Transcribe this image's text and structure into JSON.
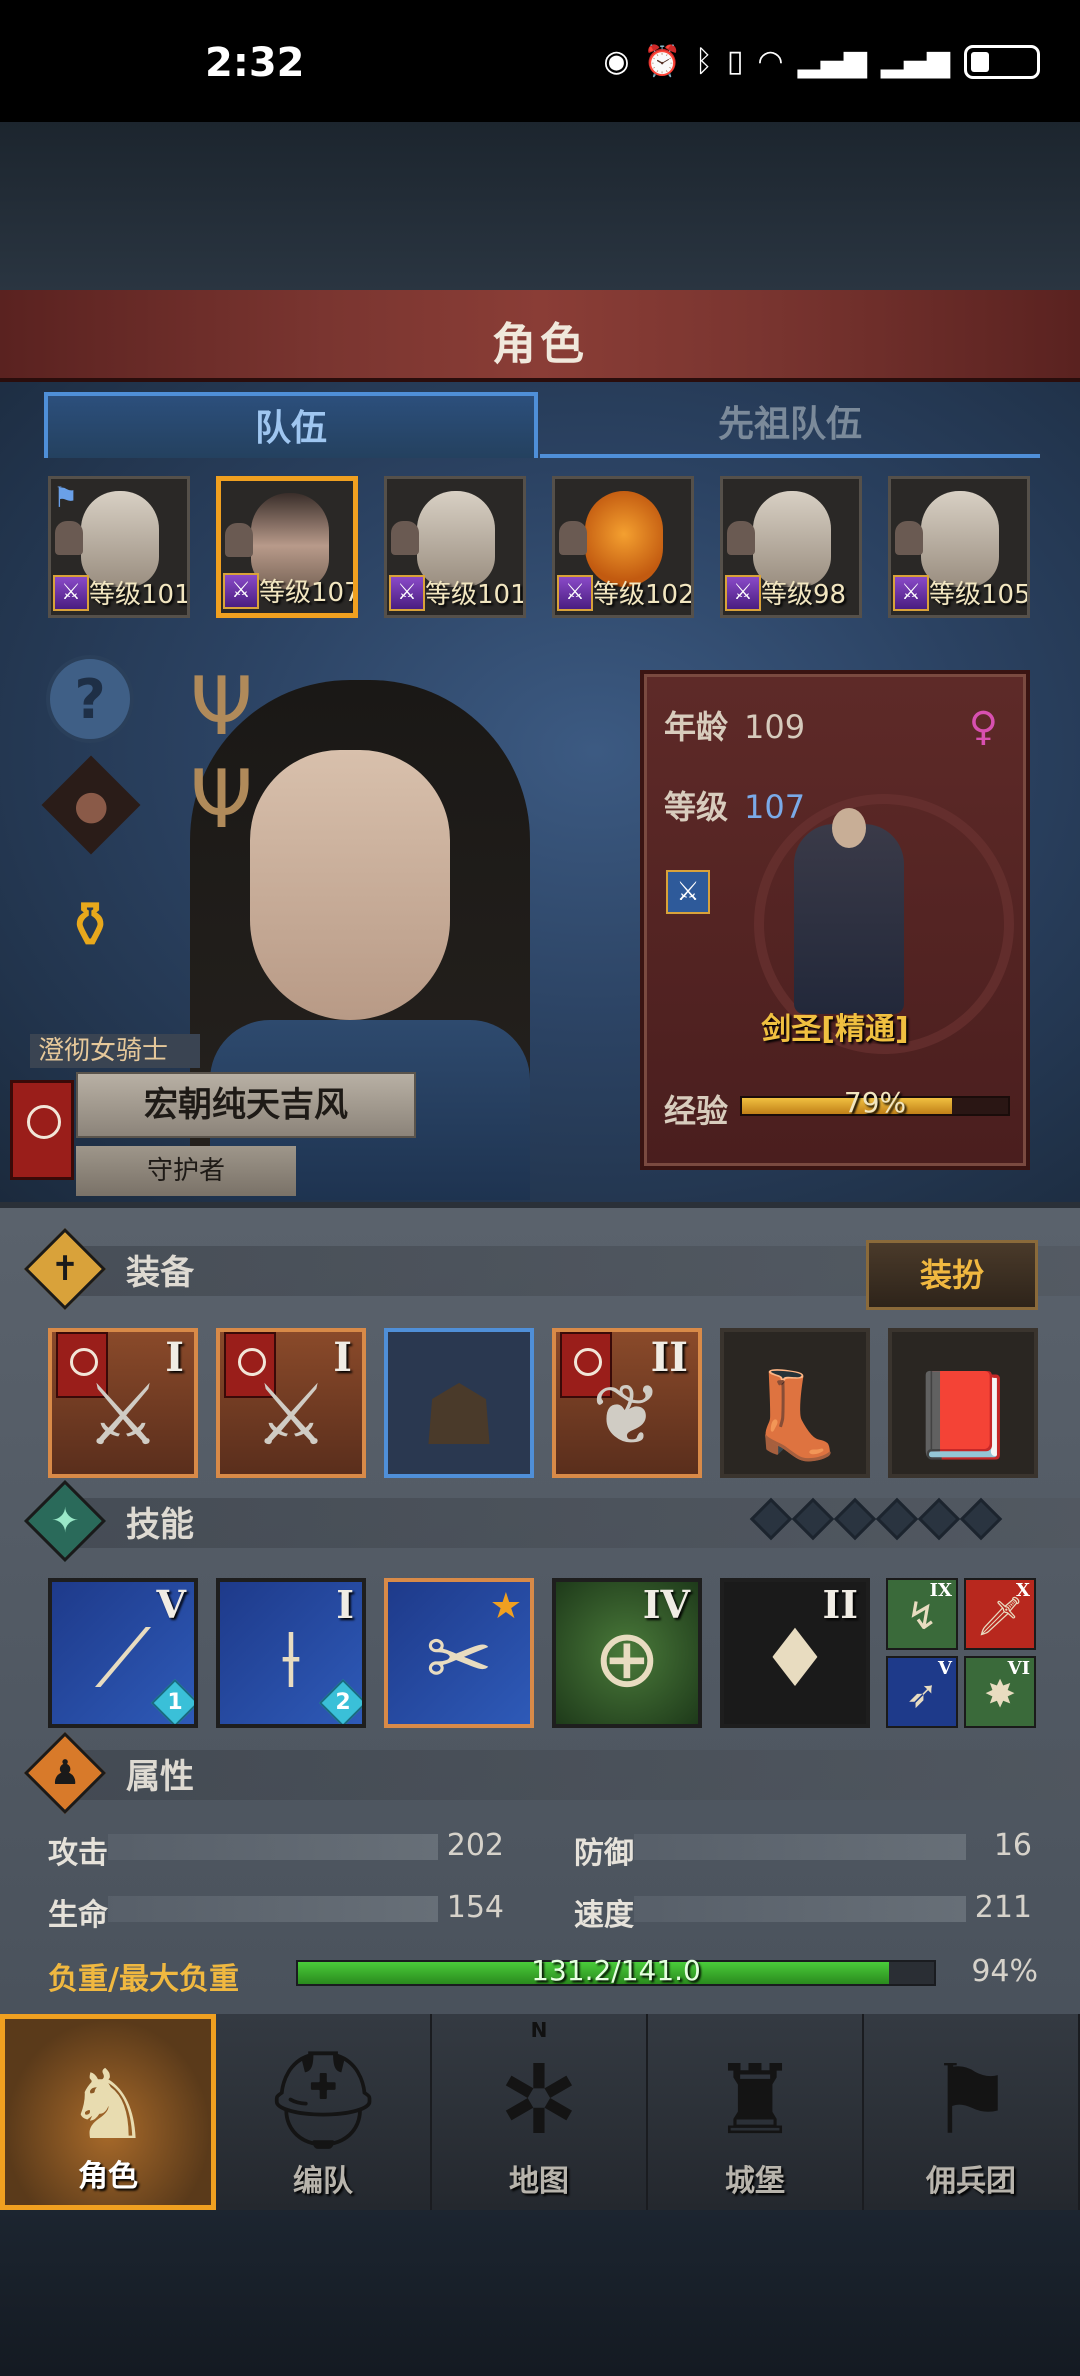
{
  "status_bar": {
    "time": "2:32",
    "icons": [
      "eye-icon",
      "alarm-icon",
      "bluetooth-icon",
      "vibrate-icon",
      "wifi-icon",
      "signal-4g-icon",
      "signal-5g-icon",
      "battery-icon"
    ]
  },
  "header": {
    "title": "角色"
  },
  "tabs": [
    {
      "label": "队伍",
      "active": true
    },
    {
      "label": "先祖队伍",
      "active": false
    }
  ],
  "roster": [
    {
      "level": "等级101",
      "flag": true,
      "selected": false,
      "face": "light"
    },
    {
      "level": "等级107",
      "flag": false,
      "selected": true,
      "face": "dark"
    },
    {
      "level": "等级101",
      "flag": false,
      "selected": false,
      "face": "light"
    },
    {
      "level": "等级102",
      "flag": false,
      "selected": false,
      "face": "pumpkin"
    },
    {
      "level": "等级98",
      "flag": false,
      "selected": false,
      "face": "light"
    },
    {
      "level": "等级105",
      "flag": false,
      "selected": false,
      "face": "light"
    }
  ],
  "hero": {
    "title": "澄彻女骑士",
    "name": "宏朝纯天吉风",
    "role": "守护者"
  },
  "info": {
    "age_label": "年龄",
    "age": "109",
    "level_label": "等级",
    "level": "107",
    "class_name": "剑圣[精通]",
    "exp_label": "经验",
    "exp_text": "79%",
    "exp_fraction": 0.79
  },
  "equipment": {
    "label": "装备",
    "dress_button": "装扮",
    "slots": [
      {
        "rarity": "orange",
        "roman": "I",
        "banner": true,
        "icon": "weapon-icon",
        "glyph": "⚔"
      },
      {
        "rarity": "orange",
        "roman": "I",
        "banner": true,
        "icon": "weapon-icon",
        "glyph": "⚔"
      },
      {
        "rarity": "blue",
        "roman": "",
        "banner": false,
        "icon": "hood-icon",
        "glyph": "☗"
      },
      {
        "rarity": "orange",
        "roman": "II",
        "banner": true,
        "icon": "armor-icon",
        "glyph": "❦"
      },
      {
        "rarity": "plain",
        "roman": "",
        "banner": false,
        "icon": "boots-icon",
        "glyph": "👢"
      },
      {
        "rarity": "plain",
        "roman": "",
        "banner": false,
        "icon": "book-icon",
        "glyph": "📕"
      }
    ]
  },
  "skills": {
    "label": "技能",
    "pip_count": 6,
    "slots": [
      {
        "style": "blue",
        "roman": "V",
        "gem": "1",
        "star": false,
        "icon": "slash-skill-icon",
        "glyph": "⟋"
      },
      {
        "style": "blue",
        "roman": "I",
        "gem": "2",
        "star": false,
        "icon": "strike-skill-icon",
        "glyph": "⟊"
      },
      {
        "style": "blue",
        "roman": "",
        "gem": "",
        "star": true,
        "icon": "sword-skill-icon",
        "glyph": "✂"
      },
      {
        "style": "green",
        "roman": "IV",
        "gem": "",
        "star": false,
        "icon": "target-skill-icon",
        "glyph": "⊕"
      },
      {
        "style": "dark",
        "roman": "II",
        "gem": "",
        "star": false,
        "icon": "crystal-skill-icon",
        "glyph": "♦"
      }
    ],
    "mini": [
      {
        "style": "g",
        "roman": "IX",
        "icon": "swirl-skill-icon",
        "glyph": "↯"
      },
      {
        "style": "r",
        "roman": "X",
        "icon": "blade-skill-icon",
        "glyph": "🗡"
      },
      {
        "style": "b",
        "roman": "V",
        "icon": "bird-skill-icon",
        "glyph": "➶"
      },
      {
        "style": "g",
        "roman": "VI",
        "icon": "burst-skill-icon",
        "glyph": "✸"
      }
    ]
  },
  "attributes": {
    "label": "属性",
    "attack_label": "攻击",
    "attack": "202",
    "defense_label": "防御",
    "defense": "16",
    "hp_label": "生命",
    "hp": "154",
    "speed_label": "速度",
    "speed": "211",
    "weight_label": "负重/最大负重",
    "weight_text": "131.2/141.0",
    "weight_pct": "94%",
    "weight_fraction": 0.93
  },
  "nav": [
    {
      "label": "角色",
      "active": true,
      "icon": "knight-icon",
      "glyph": "♞"
    },
    {
      "label": "编队",
      "active": false,
      "icon": "helmet-icon",
      "glyph": "⛑"
    },
    {
      "label": "地图",
      "active": false,
      "icon": "compass-icon",
      "glyph": "✲",
      "north": "N"
    },
    {
      "label": "城堡",
      "active": false,
      "icon": "castle-icon",
      "glyph": "♜"
    },
    {
      "label": "佣兵团",
      "active": false,
      "icon": "mercenary-icon",
      "glyph": "⚑"
    }
  ]
}
